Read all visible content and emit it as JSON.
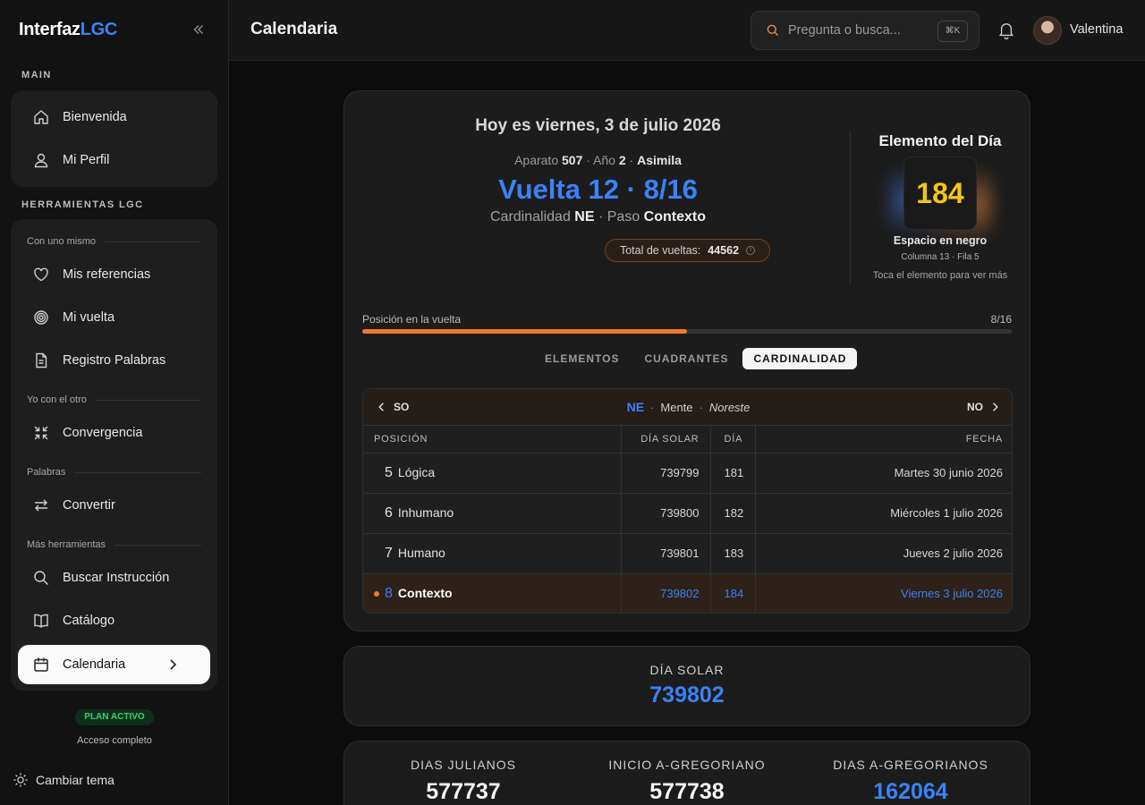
{
  "brand": {
    "name_main": "Interfaz",
    "name_accent": "LGC"
  },
  "sidebar": {
    "main_title": "MAIN",
    "main_items": [
      {
        "label": "Bienvenida",
        "icon": "home-icon"
      },
      {
        "label": "Mi Perfil",
        "icon": "user-icon"
      }
    ],
    "tools_title": "HERRAMIENTAS LGC",
    "subheads": [
      "Con uno mismo",
      "Yo con el otro",
      "Palabras",
      "Más herramientas"
    ],
    "tool_items": [
      {
        "label": "Mis referencias",
        "icon": "heart-icon"
      },
      {
        "label": "Mi vuelta",
        "icon": "spiral-icon"
      },
      {
        "label": "Registro Palabras",
        "icon": "document-icon"
      },
      {
        "label": "Convergencia",
        "icon": "converge-icon"
      },
      {
        "label": "Convertir",
        "icon": "swap-icon"
      },
      {
        "label": "Buscar Instrucción",
        "icon": "search-icon"
      },
      {
        "label": "Catálogo",
        "icon": "book-icon"
      },
      {
        "label": "Calendaria",
        "icon": "calendar-icon",
        "active": true
      }
    ],
    "plan_badge": "PLAN ACTIVO",
    "plan_sub": "Acceso completo",
    "theme_toggle": "Cambiar tema"
  },
  "topbar": {
    "title": "Calendaria",
    "search_placeholder": "Pregunta o busca...",
    "shortcut": "⌘K",
    "user_name": "Valentina"
  },
  "today": {
    "date_line": "Hoy es viernes, 3 de julio 2026",
    "aparato_label": "Aparato",
    "aparato": "507",
    "anio_label": "Año",
    "anio": "2",
    "asimila": "Asimila",
    "vuelta_line": "Vuelta 12 · 8/16",
    "cardinalidad_label": "Cardinalidad",
    "cardinalidad": "NE",
    "paso_label": "Paso",
    "paso": "Contexto",
    "total_label": "Total de vueltas:",
    "total_value": "44562"
  },
  "element": {
    "title": "Elemento del Día",
    "number": "184",
    "name": "Espacio en negro",
    "position": "Columna 13 · Fila 5",
    "hint": "Toca el elemento para ver más"
  },
  "progress": {
    "label": "Posición en la vuelta",
    "value_text": "8/16",
    "fraction": 0.5
  },
  "tabs": [
    "ELEMENTOS",
    "CUADRANTES",
    "CARDINALIDAD"
  ],
  "active_tab": 2,
  "cardinal_nav": {
    "prev": "SO",
    "current": "NE",
    "meaning": "Mente",
    "name": "Noreste",
    "next": "NO"
  },
  "table": {
    "headers": [
      "POSICIÓN",
      "DÍA SOLAR",
      "DÍA",
      "FECHA"
    ],
    "rows": [
      {
        "num": "5",
        "name": "Lógica",
        "solar": "739799",
        "dia": "181",
        "fecha": "Martes 30 junio 2026"
      },
      {
        "num": "6",
        "name": "Inhumano",
        "solar": "739800",
        "dia": "182",
        "fecha": "Miércoles 1 julio 2026"
      },
      {
        "num": "7",
        "name": "Humano",
        "solar": "739801",
        "dia": "183",
        "fecha": "Jueves 2 julio 2026"
      },
      {
        "num": "8",
        "name": "Contexto",
        "solar": "739802",
        "dia": "184",
        "fecha": "Viernes 3 julio 2026",
        "current": true
      }
    ]
  },
  "solar": {
    "label": "DÍA SOLAR",
    "value": "739802"
  },
  "stats": [
    {
      "label": "DIAS JULIANOS",
      "value": "577737"
    },
    {
      "label": "INICIO A-GREGORIANO",
      "value": "577738"
    },
    {
      "label": "DIAS A-GREGORIANOS",
      "value": "162064"
    }
  ],
  "colors": {
    "accent_blue": "#3b82f6",
    "accent_orange": "#f07a2a",
    "element_yellow": "#f5c518",
    "plan_green": "#3ecf6a"
  }
}
